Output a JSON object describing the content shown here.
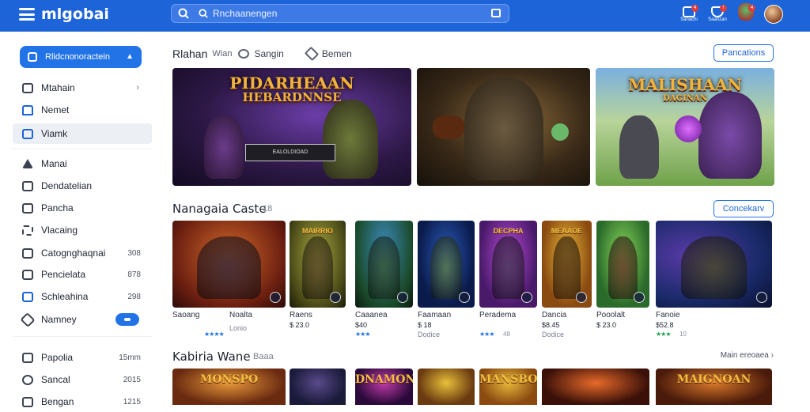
{
  "app": {
    "name": "mlgobai"
  },
  "search": {
    "placeholder": "Rnchaanengen"
  },
  "colors": {
    "accent": "#1c64d8",
    "button": "#2173e6",
    "badge": "#e23b3b",
    "star_blue": "#2173e6",
    "star_green": "#1e9e4a"
  },
  "topbar": {
    "icons": [
      {
        "name": "cart-icon",
        "label": "Sanachi",
        "badge": "4"
      },
      {
        "name": "notification-icon",
        "label": "Saanzan",
        "badge": "!"
      },
      {
        "name": "friends-icon",
        "label": "",
        "badge": "4"
      }
    ]
  },
  "sidebar": {
    "primary": {
      "label": "Rlidcnonoractein",
      "icon": "settings-icon"
    },
    "items": [
      {
        "label": "Mtahain",
        "icon": "mail-icon"
      },
      {
        "label": "Nemet",
        "icon": "home-icon"
      },
      {
        "label": "Viamk",
        "icon": "library-icon"
      },
      {
        "label": "Manai",
        "icon": "star-icon"
      },
      {
        "label": "Dendatelian",
        "icon": "download-icon"
      },
      {
        "label": "Pancha",
        "icon": "calendar-icon"
      },
      {
        "label": "Vlacaing",
        "icon": "grid-icon"
      },
      {
        "label": "Catognghaqnai",
        "count": "308",
        "icon": "category-icon"
      },
      {
        "label": "Pencielata",
        "count": "878",
        "icon": "folder-icon"
      },
      {
        "label": "Schleahina",
        "count": "298",
        "icon": "list-icon"
      },
      {
        "label": "Namney",
        "icon": "tag-icon"
      },
      {
        "label": "Papolia",
        "count": "15mm",
        "icon": "chat-icon"
      },
      {
        "label": "Sancal",
        "count": "2015",
        "icon": "search-icon"
      },
      {
        "label": "Bengan",
        "count": "1215",
        "icon": "book-icon"
      }
    ]
  },
  "tabs": [
    {
      "label": "Rlahan",
      "sub": "Wian"
    },
    {
      "label": "Sangin",
      "icon": "sort-icon"
    },
    {
      "label": "Bemen",
      "icon": "filter-icon"
    }
  ],
  "featured_button": "Pancations",
  "hero": [
    {
      "title": "PIDARHEAAN",
      "title2": "HEBARDNNSE",
      "plate": "EALOLDIOAD"
    },
    {
      "title": "",
      "title2": "",
      "plate": ""
    },
    {
      "title": "MALISHAAN",
      "title2": "DAGINAN",
      "plate": ""
    }
  ],
  "section1": {
    "title": "Nanagaia Caste",
    "sub": "18",
    "button": "Concekarv"
  },
  "cards": [
    {
      "title": "",
      "name": "Saoang",
      "price": "",
      "meta": "",
      "rating": "★★★★",
      "rating_color": "blue",
      "rating_text": ""
    },
    {
      "title": "",
      "name": "Noalta",
      "price": "",
      "meta": "Lonio",
      "rating": "",
      "rating_color": "blue",
      "rating_text": ""
    },
    {
      "title": "MAIRRIO",
      "name": "Raens",
      "price": "$ 23.0",
      "meta": "",
      "rating": "",
      "rating_color": "blue",
      "rating_text": ""
    },
    {
      "title": "",
      "name": "Caaanea",
      "price": "$40",
      "meta": "",
      "rating": "★★★",
      "rating_color": "blue",
      "rating_text": ""
    },
    {
      "title": "",
      "name": "Faamaan",
      "price": "$ 18",
      "meta": "Dodice",
      "rating": "",
      "rating_color": "blue",
      "rating_text": ""
    },
    {
      "title": "DECPHA",
      "name": "Peradema",
      "price": "",
      "meta": "",
      "rating": "★★★",
      "rating_color": "blue",
      "rating_text": "48"
    },
    {
      "title": "MEAAOE",
      "name": "Dancia",
      "price": "$8.45",
      "meta": "Dodice",
      "rating": "",
      "rating_color": "blue",
      "rating_text": ""
    },
    {
      "title": "",
      "name": "Pooolalt",
      "price": "$ 23.0",
      "meta": "",
      "rating": "",
      "rating_color": "blue",
      "rating_text": ""
    },
    {
      "title": "",
      "name": "Fanoie",
      "price": "$52.8",
      "meta": "",
      "rating": "★★★",
      "rating_color": "green",
      "rating_text": "10"
    }
  ],
  "section2": {
    "title": "Kabiria Wane",
    "sub": "Baaa",
    "more": "Main ereoaea"
  },
  "bottom_cards": [
    {
      "title": "MONSPO"
    },
    {
      "title": ""
    },
    {
      "title": "DNAMON"
    },
    {
      "title": ""
    },
    {
      "title": "MANSBO"
    },
    {
      "title": ""
    },
    {
      "title": "MAIGNOAN"
    }
  ]
}
